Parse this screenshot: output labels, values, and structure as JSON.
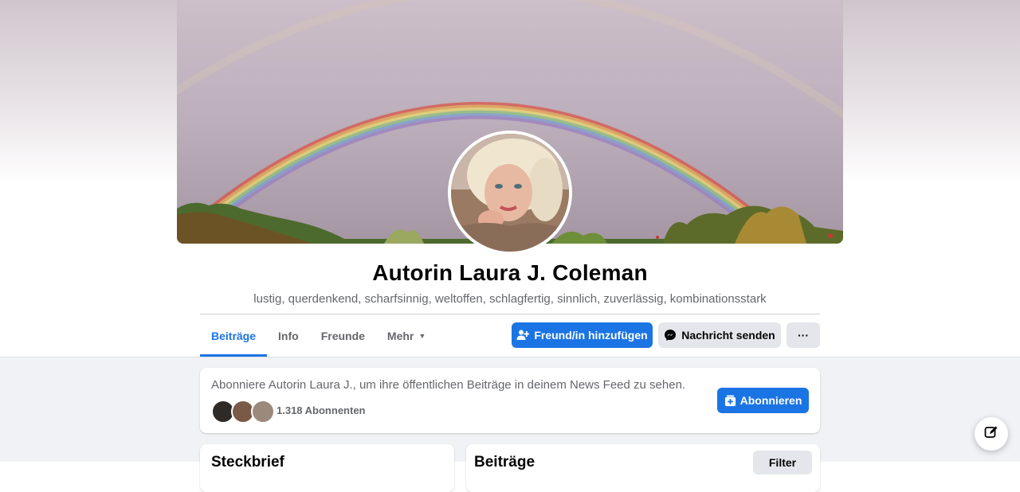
{
  "profile": {
    "name": "Autorin Laura J. Coleman",
    "bio": "lustig, querdenkend, scharfsinnig, weltoffen, schlagfertig, sinnlich, zuverlässig, kombinationsstark"
  },
  "tabs": [
    {
      "label": "Beiträge",
      "active": true
    },
    {
      "label": "Info",
      "active": false
    },
    {
      "label": "Freunde",
      "active": false
    },
    {
      "label": "Mehr",
      "active": false
    }
  ],
  "actions": {
    "add_friend": "Freund/in hinzufügen",
    "send_message": "Nachricht senden",
    "more": "···"
  },
  "subscribe": {
    "text": "Abonniere Autorin Laura J., um ihre öffentlichen Beiträge in deinem News Feed zu sehen.",
    "follower_count": "1.318 Abonnenten",
    "button": "Abonnieren"
  },
  "sections": {
    "intro_title": "Steckbrief",
    "posts_title": "Beiträge",
    "filter_label": "Filter"
  },
  "colors": {
    "accent": "#1b74e4",
    "secondary_button": "#e4e6eb",
    "feed_background": "#f0f2f5"
  },
  "icons": {
    "add_friend": "person-plus-icon",
    "send_message": "messenger-icon",
    "subscribe": "subscribe-icon",
    "compose": "compose-icon",
    "more_caret": "caret-down-icon"
  }
}
